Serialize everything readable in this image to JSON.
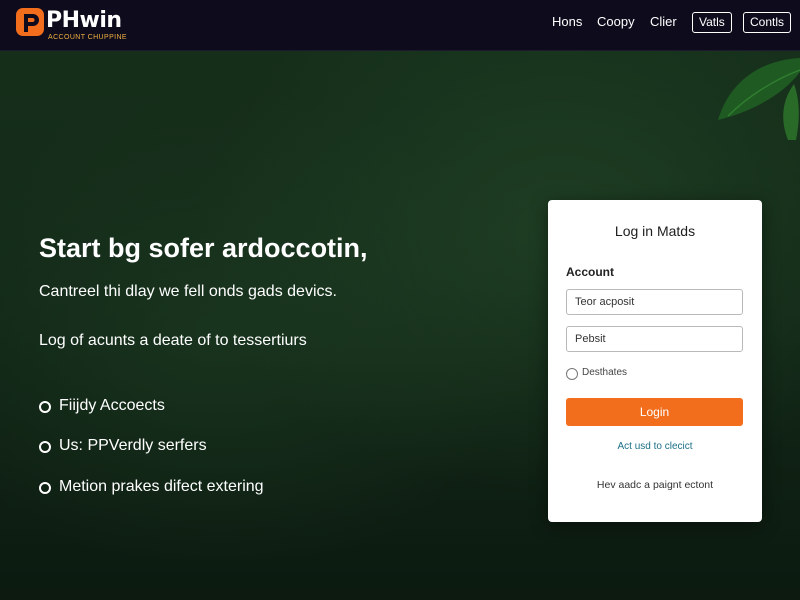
{
  "brand": {
    "name": "PHwin",
    "tagline": "ACCOUNT CHUPPINE",
    "colors": {
      "orange": "#f26d1c",
      "header_bg": "#0e0b1c",
      "bg_green": "#14291a"
    }
  },
  "nav": {
    "links": [
      "Hons",
      "Coopy",
      "Clier"
    ],
    "buttons": [
      "Vatls",
      "Contls"
    ]
  },
  "hero": {
    "title": "Start bg sofer ardoccotin,",
    "subtitle": "Cantreel thi dlay we fell onds gads devics.",
    "subtitle2": "Log of acunts a deate of to tessertiurs",
    "features": [
      "Fiijdy Accoects",
      "Us: PPVerdly serfers",
      "Metion prakes difect extering"
    ]
  },
  "login": {
    "title": "Log in Matds",
    "account_label": "Account",
    "username_placeholder": "Teor acposit",
    "password_placeholder": "Pebsit",
    "remember_label": "Desthates",
    "login_button": "Login",
    "link_text": "Act usd to clecict",
    "footer_text": "Hev aadc a paignt ectont"
  },
  "icons": {
    "logo": "phwin-logo-icon",
    "leaf": "leaf-icon",
    "bullet": "circle-bullet-icon"
  }
}
